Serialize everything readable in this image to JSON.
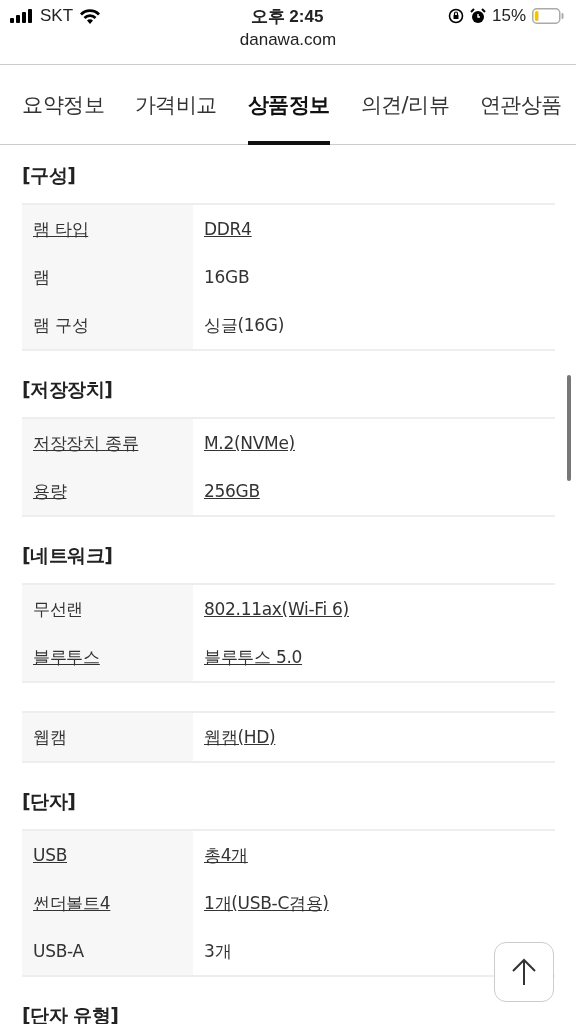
{
  "status_bar": {
    "carrier": "SKT",
    "time": "오후 2:45",
    "battery": "15%"
  },
  "url_bar": {
    "address": "danawa.com"
  },
  "tabs": [
    {
      "label": "요약정보",
      "selected": false
    },
    {
      "label": "가격비교",
      "selected": false
    },
    {
      "label": "상품정보",
      "selected": true
    },
    {
      "label": "의견/리뷰",
      "selected": false
    },
    {
      "label": "연관상품",
      "selected": false
    }
  ],
  "sections": [
    {
      "heading": "[구성]",
      "tables": [
        [
          {
            "name": "램 타입",
            "name_link": true,
            "value": "DDR4",
            "value_link": true
          },
          {
            "name": "램",
            "name_link": false,
            "value": "16GB",
            "value_link": false
          },
          {
            "name": "램 구성",
            "name_link": false,
            "value": "싱글(16G)",
            "value_link": false
          }
        ]
      ]
    },
    {
      "heading": "[저장장치]",
      "tables": [
        [
          {
            "name": "저장장치 종류",
            "name_link": true,
            "value": "M.2(NVMe)",
            "value_link": true
          },
          {
            "name": "용량",
            "name_link": true,
            "value": "256GB",
            "value_link": true
          }
        ]
      ]
    },
    {
      "heading": "[네트워크]",
      "tables": [
        [
          {
            "name": "무선랜",
            "name_link": false,
            "value": "802.11ax(Wi-Fi 6)",
            "value_link": true
          },
          {
            "name": "블루투스",
            "name_link": true,
            "value": "블루투스 5.0",
            "value_link": true
          }
        ],
        [
          {
            "name": "웹캠",
            "name_link": false,
            "value": "웹캠(HD)",
            "value_link": true
          }
        ]
      ]
    },
    {
      "heading": "[단자]",
      "tables": [
        [
          {
            "name": "USB",
            "name_link": true,
            "value": "총4개",
            "value_link": true
          },
          {
            "name": "썬더볼트4",
            "name_link": true,
            "value": "1개(USB-C겸용)",
            "value_link": true
          },
          {
            "name": "USB-A",
            "name_link": false,
            "value": "3개",
            "value_link": false
          }
        ]
      ]
    },
    {
      "heading": "[단자 유형]"
    }
  ]
}
